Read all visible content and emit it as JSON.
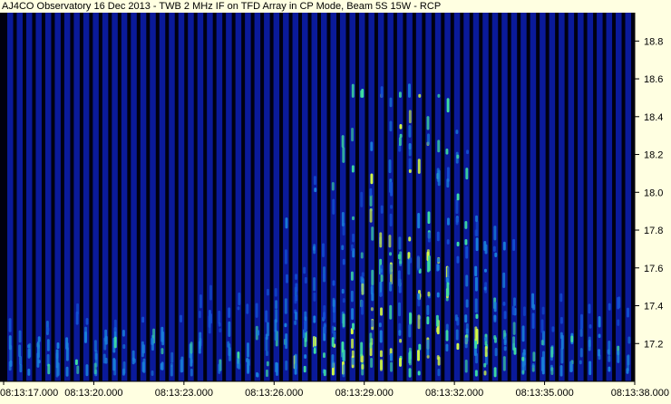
{
  "title": "AJ4CO Observatory 16 Dec 2013 - TWB 2 MHz IF on TFD Array in CP Mode, Beam 5S 15W - RCP",
  "colors": {
    "background": "#ffffe1",
    "plot_background": "#000010",
    "low": "#0a1a9a",
    "mid": "#1a7fd8",
    "high": "#3fe0a0",
    "peak": "#d8ff40"
  },
  "chart_data": {
    "type": "heatmap",
    "title": "AJ4CO Observatory 16 Dec 2013 - TWB 2 MHz IF on TFD Array in CP Mode, Beam 5S 15W - RCP",
    "x": {
      "ticks": [
        "08:13:17.000",
        "08:13:20.000",
        "08:13:23.000",
        "08:13:26.000",
        "08:13:29.000",
        "08:13:32.000",
        "08:13:35.000",
        "08:13:38.000"
      ],
      "range": [
        "08:13:17.000",
        "08:13:38.000"
      ]
    },
    "y": {
      "ticks": [
        "17.2",
        "17.4",
        "17.6",
        "17.8",
        "18.0",
        "18.2",
        "18.4",
        "18.6",
        "18.8"
      ],
      "range": [
        17.0,
        18.95
      ]
    },
    "grid": false,
    "legend": "none",
    "columns": 66
  }
}
